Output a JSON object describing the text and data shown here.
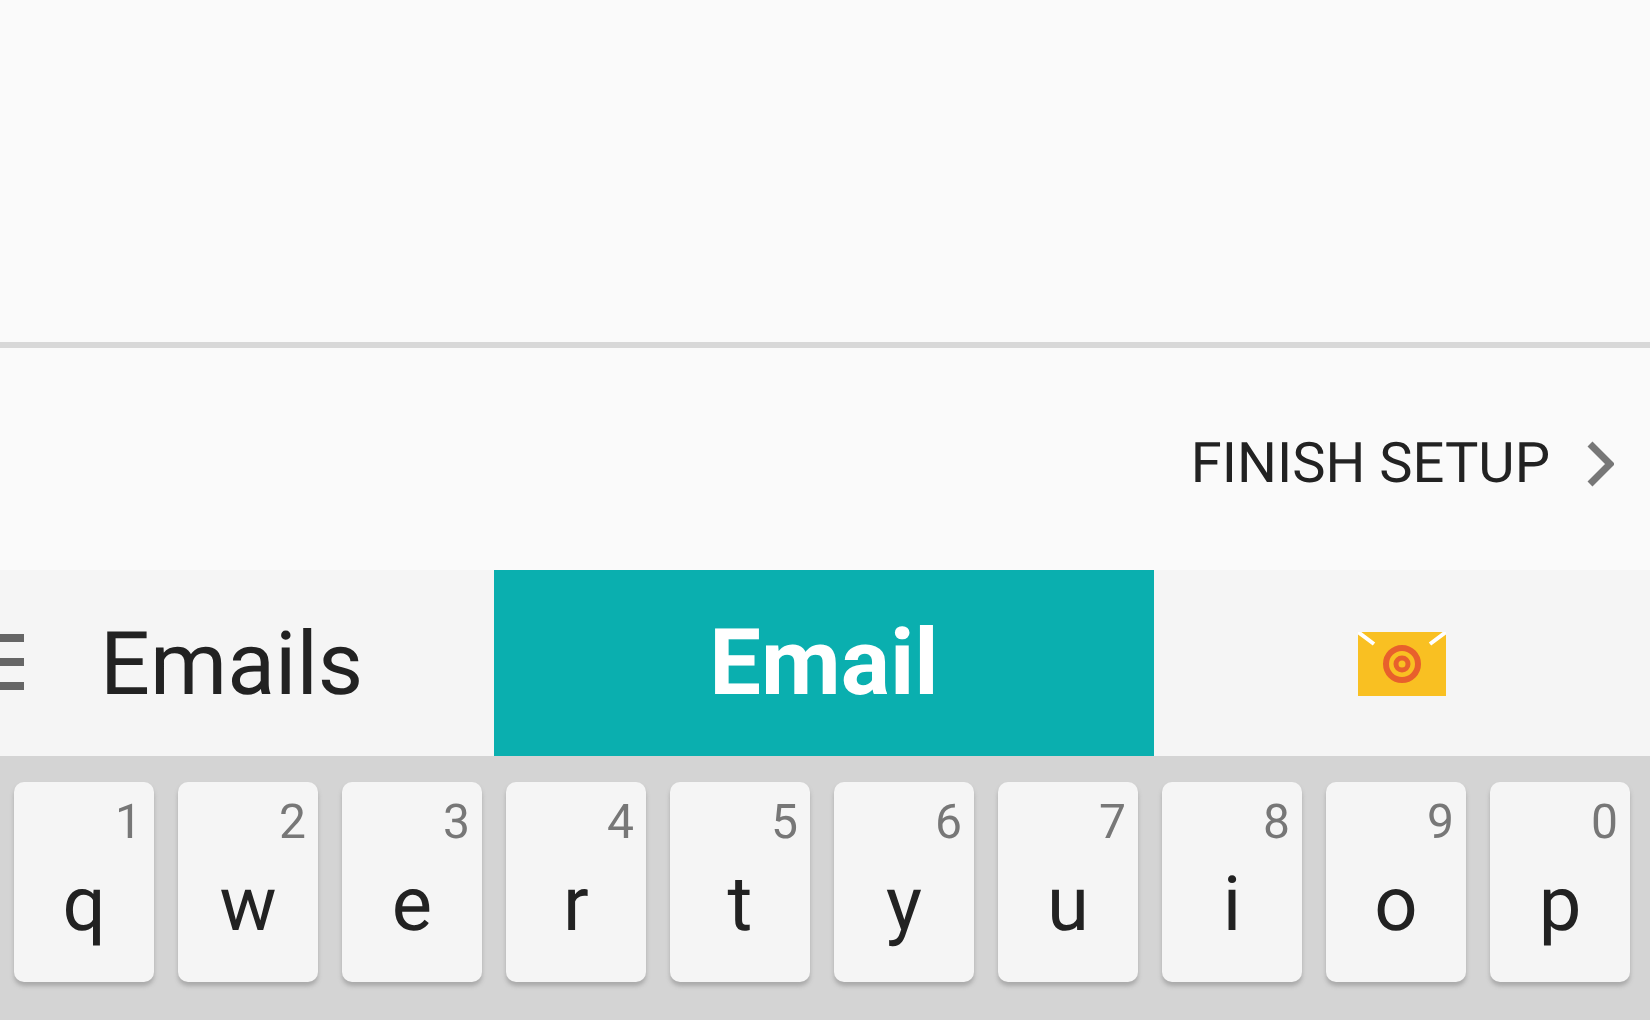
{
  "action": {
    "label": "FINISH SETUP"
  },
  "suggestions": [
    {
      "kind": "word",
      "text": "Emails",
      "selected": false
    },
    {
      "kind": "word",
      "text": "Email",
      "selected": true
    },
    {
      "kind": "emoji",
      "selected": false
    }
  ],
  "keys": [
    {
      "letter": "q",
      "number": "1"
    },
    {
      "letter": "w",
      "number": "2"
    },
    {
      "letter": "e",
      "number": "3"
    },
    {
      "letter": "r",
      "number": "4"
    },
    {
      "letter": "t",
      "number": "5"
    },
    {
      "letter": "y",
      "number": "6"
    },
    {
      "letter": "u",
      "number": "7"
    },
    {
      "letter": "i",
      "number": "8"
    },
    {
      "letter": "o",
      "number": "9"
    },
    {
      "letter": "p",
      "number": "0"
    }
  ]
}
